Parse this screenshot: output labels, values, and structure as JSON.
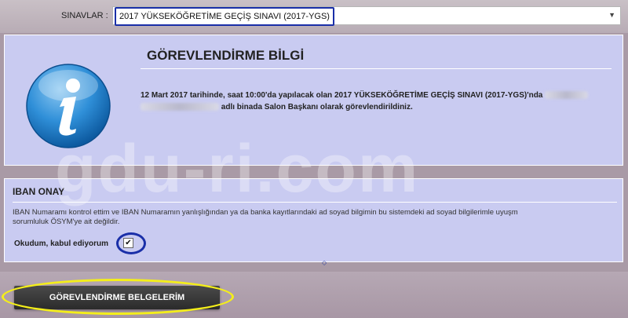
{
  "header": {
    "exam_label": "SINAVLAR :",
    "exam_selected": "2017 YÜKSEKÖĞRETİME GEÇİŞ SINAVI (2017-YGS)",
    "dropdown_arrow": "▼"
  },
  "info": {
    "icon": "info-icon",
    "title": "GÖREVLENDİRME BİLGİ",
    "text_line1": "12 Mart 2017 tarihinde, saat 10:00'da yapılacak olan 2017 YÜKSEKÖĞRETİME GEÇİŞ SINAVI (2017-YGS)'nda",
    "text_line2": "adlı binada Salon Başkanı olarak görevlendirildiniz."
  },
  "iban": {
    "title": "IBAN ONAY",
    "line1": "IBAN Numaramı kontrol ettim ve IBAN Numaramın yanlışlığından ya da banka kayıtlarındaki ad soyad bilgimin bu sistemdeki ad soyad bilgilerimle uyuşm",
    "line2": "sorumluluk ÖSYM'ye ait değildir.",
    "ack_label": "Okudum, kabul ediyorum",
    "ack_checked_glyph": "✔"
  },
  "actions": {
    "documents_button": "GÖREVLENDİRME BELGELERİM"
  },
  "watermark": "gdu-ri.com",
  "colors": {
    "panel_bg": "#c9cbf1",
    "highlight_blue": "#1a2fa8",
    "highlight_yellow": "#f4ee1a",
    "button_bg": "#2b2b2b"
  }
}
